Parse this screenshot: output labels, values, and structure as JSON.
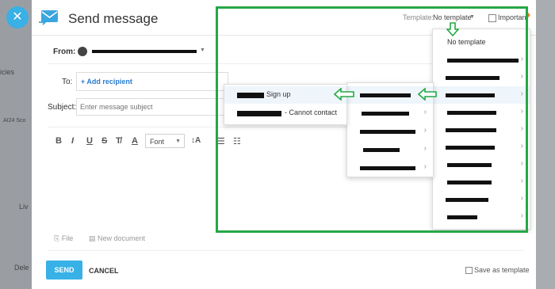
{
  "background": {
    "partial_texts": [
      "icies",
      "AI24 Sco",
      "Liv",
      "Dele"
    ]
  },
  "window": {
    "title": "Send message",
    "template_label": "Template:",
    "template_value": "No template",
    "important_label": "Important"
  },
  "compose": {
    "from_label": "From:",
    "to_label": "To:",
    "add_recipient": "+ Add recipient",
    "subject_label": "Subject:",
    "subject_placeholder": "Enter message subject",
    "font_label": "Font"
  },
  "attachments": {
    "file_label": "File",
    "new_document_label": "New document"
  },
  "footer": {
    "send_label": "SEND",
    "cancel_label": "CANCEL",
    "save_as_template_label": "Save as template"
  },
  "template_menu": {
    "no_template_label": "No template",
    "submenu_items": [
      {
        "suffix": "Sign up"
      },
      {
        "suffix": "- Cannot contact"
      }
    ]
  },
  "colors": {
    "highlight": "#25a846",
    "accent": "#37b1e6",
    "link": "#2a7bd0"
  },
  "icons": [
    "envelope-icon",
    "close-icon",
    "user-icon",
    "flame-icon",
    "file-icon",
    "document-icon",
    "chevron-right-icon",
    "arrow-left-icon",
    "arrow-down-icon"
  ]
}
